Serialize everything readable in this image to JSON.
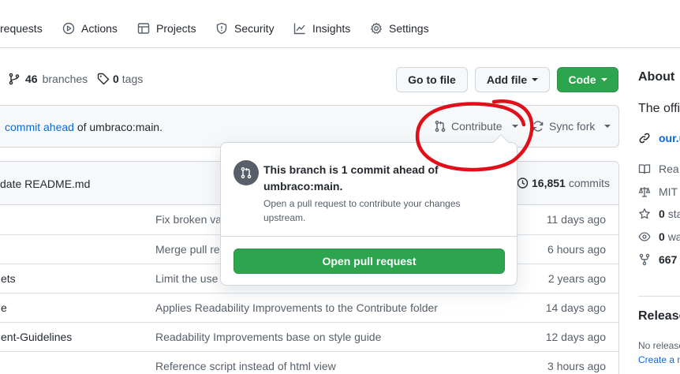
{
  "nav": {
    "pull_requests": "requests",
    "actions": "Actions",
    "projects": "Projects",
    "security": "Security",
    "insights": "Insights",
    "settings": "Settings"
  },
  "repo_meta": {
    "branches_count": "46",
    "branches_label": "branches",
    "tags_count": "0",
    "tags_label": "tags"
  },
  "buttons": {
    "go_to_file": "Go to file",
    "add_file": "Add file",
    "code": "Code"
  },
  "ahead_banner": {
    "link_text": "commit ahead",
    "suffix": "of umbraco:main.",
    "contribute": "Contribute",
    "sync_fork": "Sync fork"
  },
  "latest_commit": {
    "message": "date README.md",
    "commits_count": "16,851",
    "commits_label": "commits"
  },
  "files": [
    {
      "name": "",
      "message": "Fix broken va",
      "age": "11 days ago"
    },
    {
      "name": "",
      "message": "Merge pull re",
      "age": "6 hours ago"
    },
    {
      "name": "ets",
      "message": "Limit the use",
      "age": "2 years ago"
    },
    {
      "name": "e",
      "message": "Applies Readability Improvements to the Contribute folder",
      "age": "14 days ago"
    },
    {
      "name": "ent-Guidelines",
      "message": "Readability Improvements base on style guide",
      "age": "12 days ago"
    },
    {
      "name": "",
      "message": "Reference script instead of html view",
      "age": "3 hours ago"
    }
  ],
  "sidebar": {
    "about_title": "About",
    "description": "The offi",
    "link": "our.u",
    "readme": "Rea",
    "license": "MIT",
    "stars_count": "0",
    "stars_label": "sta",
    "watching_count": "0",
    "watching_label": "wa",
    "forks_count": "667",
    "releases_title": "Release",
    "no_releases": "No release",
    "create_release": "Create a n"
  },
  "popover": {
    "title": "This branch is 1 commit ahead of umbraco:main.",
    "description": "Open a pull request to contribute your changes upstream.",
    "button": "Open pull request"
  },
  "colors": {
    "green": "#2da44e",
    "link": "#0969da",
    "annotation": "#e0101a"
  }
}
